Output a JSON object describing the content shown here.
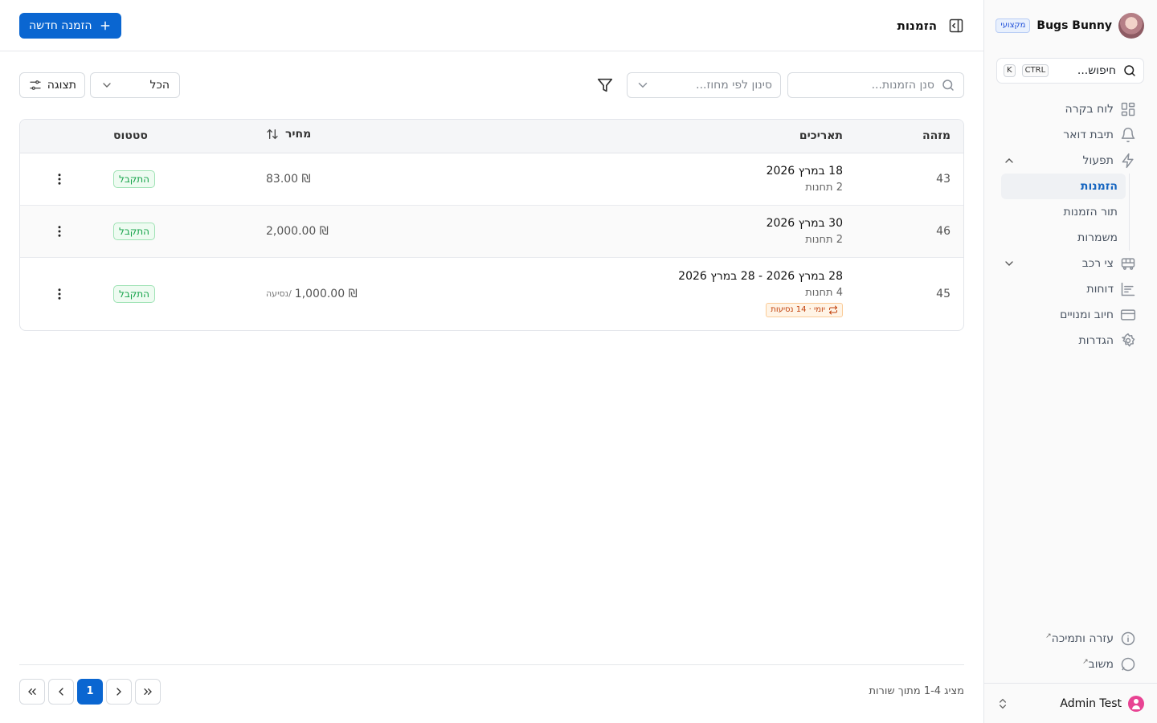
{
  "org": {
    "name": "Bugs Bunny",
    "badge": "מקצועי"
  },
  "sidebar": {
    "search_placeholder": "חיפוש...",
    "shortcut_keys": [
      "CTRL",
      "K"
    ],
    "items": [
      {
        "label": "לוח בקרה",
        "icon": "dashboard-icon"
      },
      {
        "label": "תיבת דואר",
        "icon": "bell-icon"
      },
      {
        "label": "תפעול",
        "icon": "lightning-icon",
        "expanded": true
      },
      {
        "label": "צי רכב",
        "icon": "bus-icon",
        "expanded": false
      },
      {
        "label": "דוחות",
        "icon": "chart-icon"
      },
      {
        "label": "חיוב ומנויים",
        "icon": "credit-card-icon"
      },
      {
        "label": "הגדרות",
        "icon": "gear-icon"
      }
    ],
    "sub_items": [
      {
        "label": "הזמנות",
        "active": true
      },
      {
        "label": "תור הזמנות",
        "active": false
      },
      {
        "label": "משמרות",
        "active": false
      }
    ],
    "bottom_items": [
      {
        "label": "עזרה ותמיכה",
        "icon": "info-icon"
      },
      {
        "label": "משוב",
        "icon": "message-icon"
      }
    ],
    "user": {
      "name": "Admin Test"
    }
  },
  "header": {
    "title": "הזמנות",
    "new_button": "הזמנה חדשה"
  },
  "toolbar": {
    "search_placeholder": "סנן הזמנות...",
    "contract_filter_placeholder": "סינון לפי מחוז...",
    "select_value": "הכל",
    "view_label": "תצוגה"
  },
  "table": {
    "columns": {
      "id": "מזהה",
      "dates": "תאריכים",
      "price": "מחיר",
      "status": "סטטוס"
    },
    "rows": [
      {
        "id": "43",
        "date": "18 במרץ 2026",
        "stations": "2 תחנות",
        "price": "₪ 83.00",
        "per_trip": "",
        "status": "התקבל"
      },
      {
        "id": "46",
        "date": "30 במרץ 2026",
        "stations": "2 תחנות",
        "price": "₪ 2,000.00",
        "per_trip": "",
        "status": "התקבל"
      },
      {
        "id": "45",
        "date": "28 במרץ 2026 - 28 במרץ 2026",
        "stations": "4 תחנות",
        "recurrence": "יומי · 14 נסיעות",
        "price": "₪ 1,000.00",
        "per_trip": "/נסיעה",
        "status": "התקבל"
      }
    ]
  },
  "footer": {
    "rows_info": "מציג 1-4 מתוך שורות",
    "current_page": "1"
  },
  "colors": {
    "primary": "#0a66d1",
    "success": "#16a34a",
    "warning": "#c2410c"
  }
}
